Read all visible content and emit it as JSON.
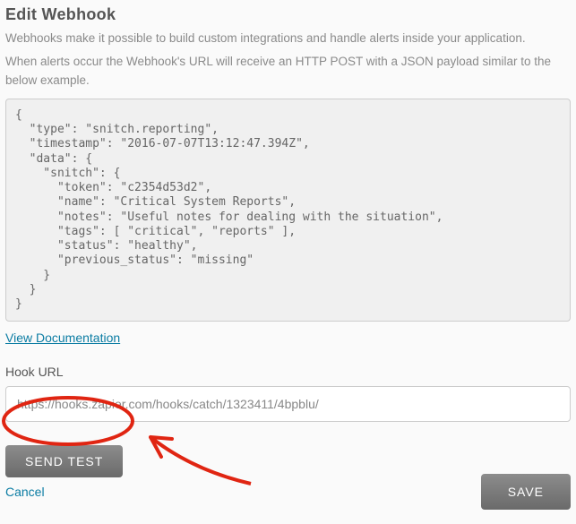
{
  "dialog": {
    "title": "Edit Webhook",
    "desc1": "Webhooks make it possible to build custom integrations and handle alerts inside your application.",
    "desc2": "When alerts occur the Webhook's URL will receive an HTTP POST with a JSON payload similar to the below example."
  },
  "code_sample": "{\n  \"type\": \"snitch.reporting\",\n  \"timestamp\": \"2016-07-07T13:12:47.394Z\",\n  \"data\": {\n    \"snitch\": {\n      \"token\": \"c2354d53d2\",\n      \"name\": \"Critical System Reports\",\n      \"notes\": \"Useful notes for dealing with the situation\",\n      \"tags\": [ \"critical\", \"reports\" ],\n      \"status\": \"healthy\",\n      \"previous_status\": \"missing\"\n    }\n  }\n}",
  "links": {
    "documentation": "View Documentation"
  },
  "form": {
    "url_label": "Hook URL",
    "url_value": "https://hooks.zapier.com/hooks/catch/1323411/4bpblu/",
    "send_test_label": "SEND TEST"
  },
  "footer": {
    "cancel_label": "Cancel",
    "save_label": "SAVE"
  }
}
